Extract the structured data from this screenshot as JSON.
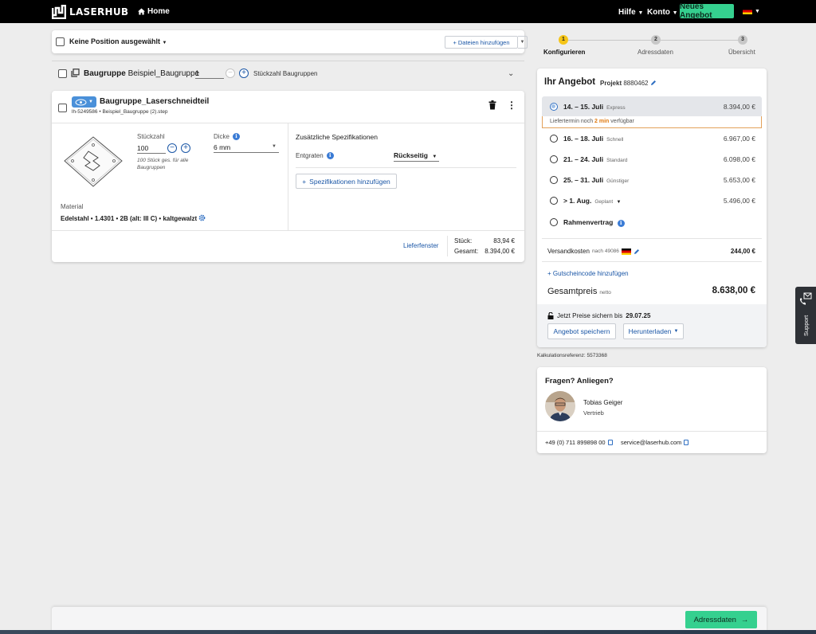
{
  "header": {
    "logo_text": "LASERHUB",
    "home_label": "Home",
    "help_label": "Hilfe",
    "account_label": "Konto",
    "new_offer_label": "Neues Angebot"
  },
  "selection": {
    "label": "Keine Position ausgewählt",
    "add_files_label": "Dateien hinzufügen"
  },
  "group": {
    "prefix": "Baugruppe",
    "name": "Beispiel_Baugruppe",
    "qty": "1",
    "qty_label": "Stückzahl Baugruppen"
  },
  "part": {
    "name": "Baugruppe_Laserschneidteil",
    "id": "lh-5249586",
    "file": "Beispiel_Baugruppe (2).step",
    "qty_label": "Stückzahl",
    "qty": "100",
    "qty_hint": "100 Stück ges. für alle Baugruppen",
    "thickness_label": "Dicke",
    "thickness": "6 mm",
    "material_label": "Material",
    "material": "Edelstahl • 1.4301 • 2B (alt: III C) • kaltgewalzt",
    "spec_title": "Zusätzliche Spezifikationen",
    "deburr_label": "Entgraten",
    "deburr_value": "Rückseitig",
    "add_spec_label": "Spezifikationen hinzufügen",
    "delivery_window_label": "Lieferfenster",
    "unit_label": "Stück:",
    "unit_price": "83,94 €",
    "total_label": "Gesamt:",
    "total_price": "8.394,00 €"
  },
  "stepper": {
    "steps": [
      {
        "num": "1",
        "label": "Konfigurieren"
      },
      {
        "num": "2",
        "label": "Adressdaten"
      },
      {
        "num": "3",
        "label": "Übersicht"
      }
    ]
  },
  "offer": {
    "title": "Ihr Angebot",
    "project_prefix": "Projekt",
    "project_no": "8880462",
    "options": [
      {
        "date": "14. – 15. Juli",
        "type": "Express",
        "price": "8.394,00 €"
      },
      {
        "date": "16. – 18. Juli",
        "type": "Schnell",
        "price": "6.967,00 €"
      },
      {
        "date": "21. – 24. Juli",
        "type": "Standard",
        "price": "6.098,00 €"
      },
      {
        "date": "25. – 31. Juli",
        "type": "Günstiger",
        "price": "5.653,00 €"
      },
      {
        "date": "> 1. Aug.",
        "type": "Geplant",
        "price": "5.496,00 €"
      }
    ],
    "avail_pre": "Liefertermin noch",
    "avail_time": "2 min",
    "avail_post": "verfügbar",
    "frame_contract": "Rahmenvertrag",
    "shipping_label": "Versandkosten",
    "shipping_dest": "nach 49086",
    "shipping_price": "244,00 €",
    "coupon_label": "+ Gutscheincode hinzufügen",
    "total_label": "Gesamtpreis",
    "total_suffix": "netto",
    "total": "8.638,00 €",
    "secure_label": "Jetzt Preise sichern bis",
    "secure_date": "29.07.25",
    "save_label": "Angebot speichern",
    "download_label": "Herunterladen"
  },
  "calc_ref": "Kalkulationsreferenz: 5573368",
  "contact": {
    "title": "Fragen? Anliegen?",
    "name": "Tobias Geiger",
    "role": "Vertrieb",
    "phone": "+49 (0) 711 899898 00",
    "email": "service@laserhub.com"
  },
  "support_label": "Support",
  "footer": {
    "next_label": "Adressdaten"
  },
  "colors": {
    "accent_green": "#35d08f",
    "link_blue": "#1a56a6",
    "step_active": "#f5c518"
  }
}
